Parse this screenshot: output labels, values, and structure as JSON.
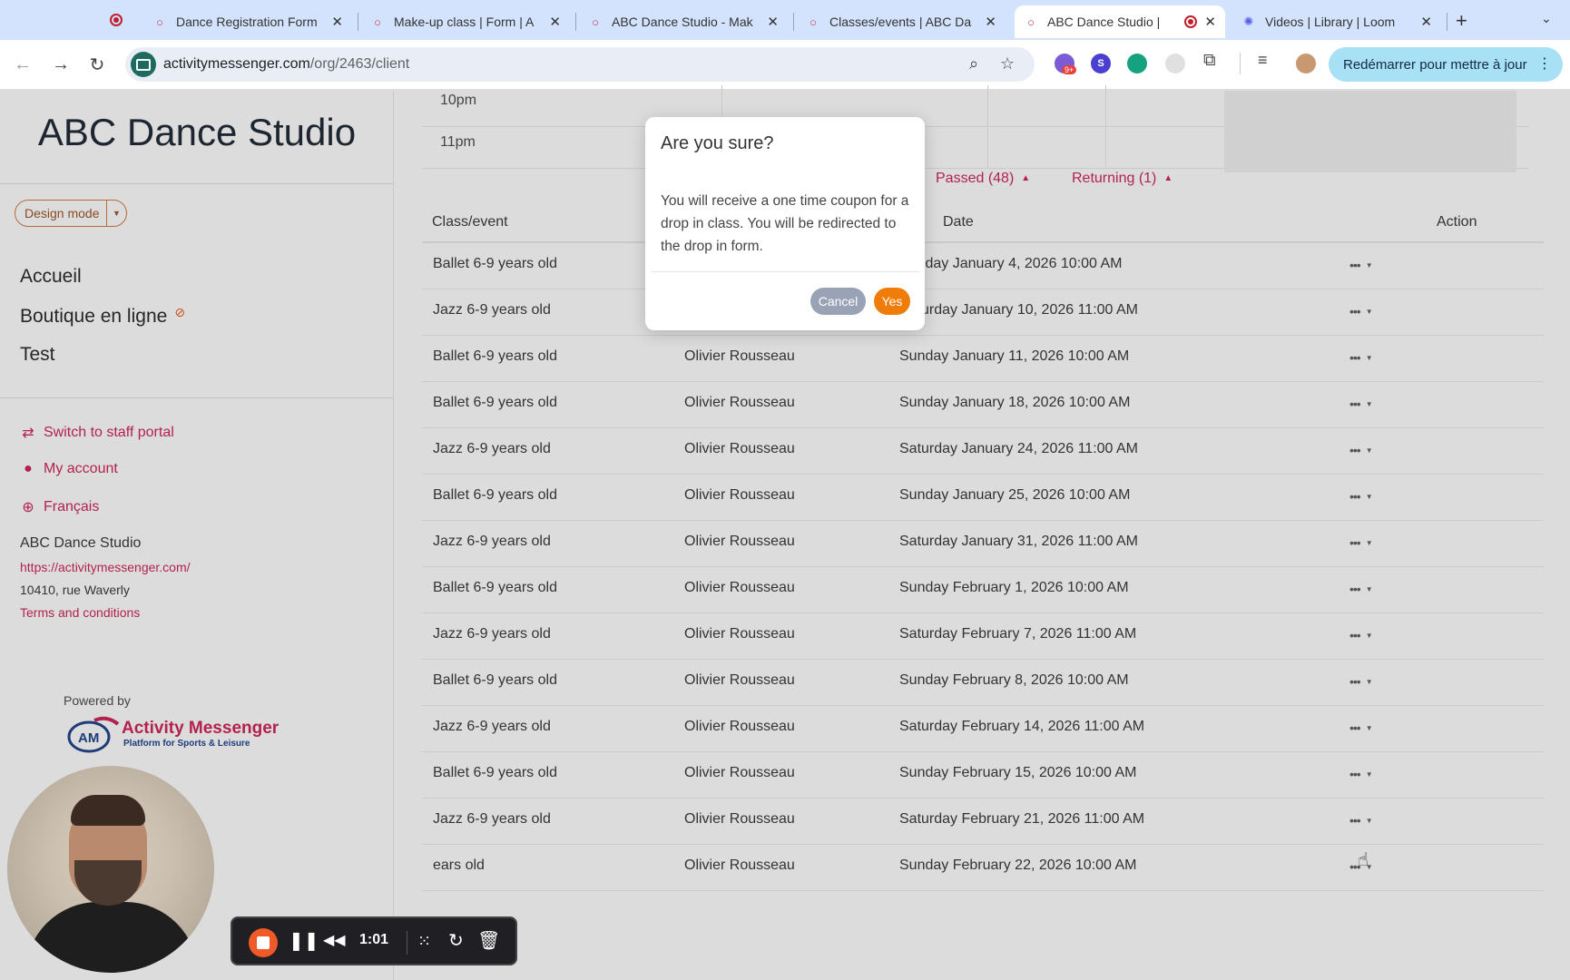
{
  "browser": {
    "tabs": [
      {
        "title": "Dance Registration Form",
        "icon": "chat-bubble-icon"
      },
      {
        "title": "Make-up class | Form | A",
        "icon": "chat-bubble-icon"
      },
      {
        "title": "ABC Dance Studio - Mak",
        "icon": "chat-bubble-icon"
      },
      {
        "title": "Classes/events | ABC Da",
        "icon": "chat-bubble-icon"
      },
      {
        "title": "ABC Dance Studio | ",
        "icon": "chat-bubble-icon"
      },
      {
        "title": "Videos | Library | Loom",
        "icon": "loom-icon"
      }
    ],
    "new_tab": "+",
    "url_host": "activitymessenger.com",
    "url_path": "/org/2463/client",
    "extension_badge": "9+",
    "ext_s": "S",
    "update_button": "Redémarrer pour mettre à jour"
  },
  "sidebar": {
    "brand": "ABC Dance Studio",
    "design_mode": "Design mode",
    "nav": [
      {
        "label": "Accueil"
      },
      {
        "label": "Boutique en ligne"
      },
      {
        "label": "Test"
      }
    ],
    "links": [
      {
        "label": "Switch to staff portal",
        "icon": "switch-arrows-icon"
      },
      {
        "label": "My account",
        "icon": "user-icon"
      },
      {
        "label": "Français",
        "icon": "globe-icon"
      }
    ],
    "org": {
      "name": "ABC Dance Studio",
      "website": "https://activitymessenger.com/",
      "address": "10410, rue Waverly",
      "terms": "Terms and conditions"
    },
    "powered_by": "Powered by",
    "logo": {
      "initials": "AM",
      "name": "Activity Messenger",
      "tagline": "Platform for Sports & Leisure"
    }
  },
  "calendar": {
    "times": [
      "10pm",
      "11pm"
    ]
  },
  "filters": {
    "passed": "Passed (48)",
    "returning": "Returning (1)"
  },
  "table": {
    "headers": {
      "class": "Class/event",
      "date": "Date",
      "action": "Action"
    },
    "rows": [
      {
        "class": "Ballet 6-9 years old",
        "instructor": "",
        "date": "Sunday January 4, 2026 10:00 AM"
      },
      {
        "class": "Jazz 6-9 years old",
        "instructor": "Olivier Rousseau",
        "date": "Saturday January 10, 2026 11:00 AM"
      },
      {
        "class": "Ballet 6-9 years old",
        "instructor": "Olivier Rousseau",
        "date": "Sunday January 11, 2026 10:00 AM"
      },
      {
        "class": "Ballet 6-9 years old",
        "instructor": "Olivier Rousseau",
        "date": "Sunday January 18, 2026 10:00 AM"
      },
      {
        "class": "Jazz 6-9 years old",
        "instructor": "Olivier Rousseau",
        "date": "Saturday January 24, 2026 11:00 AM"
      },
      {
        "class": "Ballet 6-9 years old",
        "instructor": "Olivier Rousseau",
        "date": "Sunday January 25, 2026 10:00 AM"
      },
      {
        "class": "Jazz 6-9 years old",
        "instructor": "Olivier Rousseau",
        "date": "Saturday January 31, 2026 11:00 AM"
      },
      {
        "class": "Ballet 6-9 years old",
        "instructor": "Olivier Rousseau",
        "date": "Sunday February 1, 2026 10:00 AM"
      },
      {
        "class": "Jazz 6-9 years old",
        "instructor": "Olivier Rousseau",
        "date": "Saturday February 7, 2026 11:00 AM"
      },
      {
        "class": "Ballet 6-9 years old",
        "instructor": "Olivier Rousseau",
        "date": "Sunday February 8, 2026 10:00 AM"
      },
      {
        "class": "Jazz 6-9 years old",
        "instructor": "Olivier Rousseau",
        "date": "Saturday February 14, 2026 11:00 AM"
      },
      {
        "class": "Ballet 6-9 years old",
        "instructor": "Olivier Rousseau",
        "date": "Sunday February 15, 2026 10:00 AM"
      },
      {
        "class": "Jazz 6-9 years old",
        "instructor": "Olivier Rousseau",
        "date": "Saturday February 21, 2026 11:00 AM"
      },
      {
        "class": "ears old",
        "instructor": "Olivier Rousseau",
        "date": "Sunday February 22, 2026 10:00 AM"
      }
    ]
  },
  "modal": {
    "title": "Are you sure?",
    "body": "You will receive a one time coupon for a drop in class. You will be redirected to the drop in form.",
    "cancel": "Cancel",
    "yes": "Yes"
  },
  "loom": {
    "time": "1:01"
  },
  "colors": {
    "accent": "#b3224e",
    "yes_button": "#f07d0a",
    "cancel_button": "#9aa3b5",
    "update_button": "#a8e0f5"
  }
}
